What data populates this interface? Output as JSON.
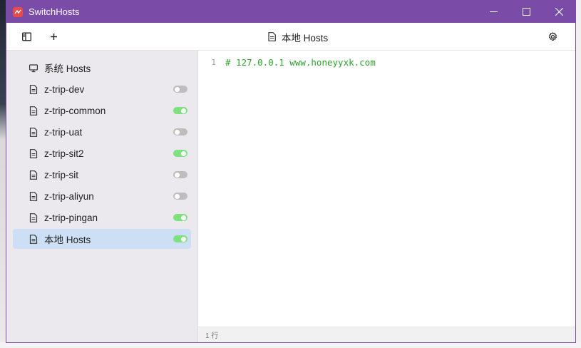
{
  "window": {
    "title": "SwitchHosts"
  },
  "toolbar": {
    "current_title": "本地 Hosts"
  },
  "sidebar": {
    "items": [
      {
        "label": "系统 Hosts",
        "icon": "monitor-icon",
        "toggle": null,
        "active": false
      },
      {
        "label": "z-trip-dev",
        "icon": "file-icon",
        "toggle": false,
        "active": false
      },
      {
        "label": "z-trip-common",
        "icon": "file-icon",
        "toggle": true,
        "active": false
      },
      {
        "label": "z-trip-uat",
        "icon": "file-icon",
        "toggle": false,
        "active": false
      },
      {
        "label": "z-trip-sit2",
        "icon": "file-icon",
        "toggle": true,
        "active": false
      },
      {
        "label": "z-trip-sit",
        "icon": "file-icon",
        "toggle": false,
        "active": false
      },
      {
        "label": "z-trip-aliyun",
        "icon": "file-icon",
        "toggle": false,
        "active": false
      },
      {
        "label": "z-trip-pingan",
        "icon": "file-icon",
        "toggle": true,
        "active": false
      },
      {
        "label": "本地 Hosts",
        "icon": "file-icon",
        "toggle": true,
        "active": true
      }
    ]
  },
  "editor": {
    "lines": [
      {
        "number": "1",
        "text": "# 127.0.0.1 www.honeyyxk.com"
      }
    ]
  },
  "statusbar": {
    "text": "1 行"
  },
  "colors": {
    "titlebar": "#7b4ba8",
    "sidebar_bg": "#ece9ee",
    "active_item": "#cddff4",
    "toggle_on": "#7ee07e",
    "toggle_off": "#bdbdbd",
    "comment": "#2ea02e"
  }
}
